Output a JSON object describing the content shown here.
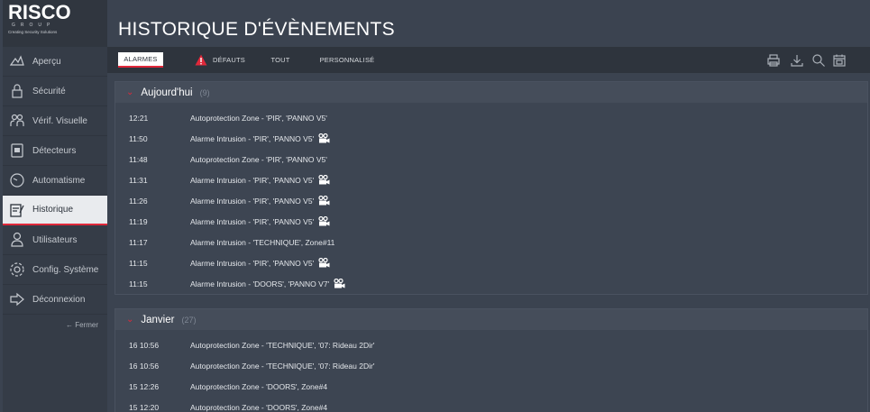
{
  "logo": {
    "brand": "RISCO",
    "group": "GROUP",
    "tagline": "Creating Security Solutions"
  },
  "sidebar": {
    "items": [
      {
        "label": "Aperçu",
        "icon": "overview-icon"
      },
      {
        "label": "Sécurité",
        "icon": "lock-icon"
      },
      {
        "label": "Vérif. Visuelle",
        "icon": "people-icon"
      },
      {
        "label": "Détecteurs",
        "icon": "detector-icon"
      },
      {
        "label": "Automatisme",
        "icon": "clock-icon"
      },
      {
        "label": "Historique",
        "icon": "history-icon"
      },
      {
        "label": "Utilisateurs",
        "icon": "user-icon"
      },
      {
        "label": "Config. Système",
        "icon": "gear-icon"
      },
      {
        "label": "Déconnexion",
        "icon": "logout-icon"
      }
    ],
    "active_index": 5,
    "close_label": "← Fermer"
  },
  "header": {
    "title": "HISTORIQUE D'ÉVÈNEMENTS"
  },
  "tabs": [
    {
      "label": "ALARMES",
      "active": true
    },
    {
      "label": "DÉFAUTS",
      "active": false,
      "icon": "warning-icon"
    },
    {
      "label": "TOUT",
      "active": false
    },
    {
      "label": "PERSONNALISÉ",
      "active": false
    }
  ],
  "toolbar": [
    "print-icon",
    "download-icon",
    "search-icon",
    "calendar-icon"
  ],
  "sections": [
    {
      "title": "Aujourd'hui",
      "count": "(9)",
      "rows": [
        {
          "time": "12:21",
          "text": "Autoprotection Zone - 'PIR', 'PANNO V5'",
          "camera": false
        },
        {
          "time": "11:50",
          "text": "Alarme Intrusion - 'PIR', 'PANNO V5'",
          "camera": true
        },
        {
          "time": "11:48",
          "text": "Autoprotection Zone - 'PIR', 'PANNO V5'",
          "camera": false
        },
        {
          "time": "11:31",
          "text": "Alarme Intrusion - 'PIR', 'PANNO V5'",
          "camera": true
        },
        {
          "time": "11:26",
          "text": "Alarme Intrusion - 'PIR', 'PANNO V5'",
          "camera": true
        },
        {
          "time": "11:19",
          "text": "Alarme Intrusion - 'PIR', 'PANNO V5'",
          "camera": true
        },
        {
          "time": "11:17",
          "text": "Alarme Intrusion - 'TECHNIQUE', Zone#11",
          "camera": false
        },
        {
          "time": "11:15",
          "text": "Alarme Intrusion - 'PIR', 'PANNO V5'",
          "camera": true
        },
        {
          "time": "11:15",
          "text": "Alarme Intrusion - 'DOORS', 'PANNO V7'",
          "camera": true
        }
      ]
    },
    {
      "title": "Janvier",
      "count": "(27)",
      "rows": [
        {
          "time": "16  10:56",
          "text": "Autoprotection Zone - 'TECHNIQUE', '07: Rideau 2Dir'",
          "camera": false
        },
        {
          "time": "16  10:56",
          "text": "Autoprotection Zone - 'TECHNIQUE', '07: Rideau 2Dir'",
          "camera": false
        },
        {
          "time": "15  12:26",
          "text": "Autoprotection Zone - 'DOORS', Zone#4",
          "camera": false
        },
        {
          "time": "15  12:20",
          "text": "Autoprotection Zone - 'DOORS', Zone#4",
          "camera": false
        }
      ]
    }
  ],
  "colors": {
    "accent": "#e0283a",
    "panel": "#3b4350",
    "sidebar": "#353c47"
  }
}
